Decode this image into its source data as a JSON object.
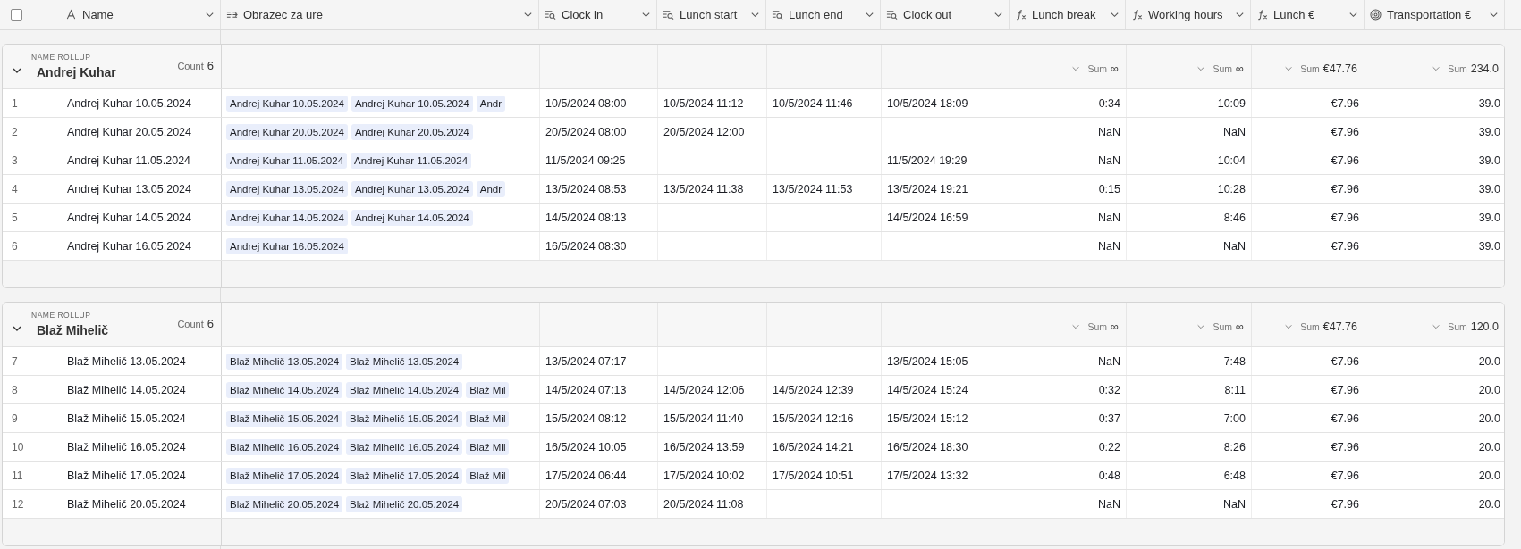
{
  "header": {
    "select_all": {
      "checked": false
    },
    "columns": [
      {
        "label": "Name",
        "kind": "text"
      },
      {
        "label": "Obrazec za ure",
        "kind": "link"
      },
      {
        "label": "Clock in",
        "kind": "lookup"
      },
      {
        "label": "Lunch start",
        "kind": "lookup"
      },
      {
        "label": "Lunch end",
        "kind": "lookup"
      },
      {
        "label": "Clock out",
        "kind": "lookup"
      },
      {
        "label": "Lunch break",
        "kind": "formula"
      },
      {
        "label": "Working hours",
        "kind": "formula"
      },
      {
        "label": "Lunch €",
        "kind": "formula"
      },
      {
        "label": "Transportation €",
        "kind": "rollup"
      }
    ]
  },
  "groups": [
    {
      "caption": "NAME ROLLUP",
      "name": "Andrej Kuhar",
      "count_label": "Count",
      "count": "6",
      "expanded": true,
      "summaries": [
        {
          "label": "Sum",
          "value": "∞"
        },
        {
          "label": "Sum",
          "value": "∞"
        },
        {
          "label": "Sum",
          "value": "€47.76"
        },
        {
          "label": "Sum",
          "value": "234.0"
        }
      ],
      "rows": [
        {
          "number": "1",
          "name": "Andrej Kuhar 10.05.2024",
          "links": [
            "Andrej Kuhar 10.05.2024",
            "Andrej Kuhar 10.05.2024",
            "Andr"
          ],
          "clock_in": "10/5/2024 08:00",
          "lunch_start": "10/5/2024 11:12",
          "lunch_end": "10/5/2024 11:46",
          "clock_out": "10/5/2024 18:09",
          "lunch_break": "0:34",
          "working_hours": "10:09",
          "lunch_eur": "€7.96",
          "transport": "39.0"
        },
        {
          "number": "2",
          "name": "Andrej Kuhar 20.05.2024",
          "links": [
            "Andrej Kuhar 20.05.2024",
            "Andrej Kuhar 20.05.2024"
          ],
          "clock_in": "20/5/2024 08:00",
          "lunch_start": "20/5/2024 12:00",
          "lunch_break": "NaN",
          "working_hours": "NaN",
          "lunch_eur": "€7.96",
          "transport": "39.0"
        },
        {
          "number": "3",
          "name": "Andrej Kuhar 11.05.2024",
          "links": [
            "Andrej Kuhar 11.05.2024",
            "Andrej Kuhar 11.05.2024"
          ],
          "clock_in": "11/5/2024 09:25",
          "clock_out": "11/5/2024 19:29",
          "lunch_break": "NaN",
          "working_hours": "10:04",
          "lunch_eur": "€7.96",
          "transport": "39.0"
        },
        {
          "number": "4",
          "name": "Andrej Kuhar 13.05.2024",
          "links": [
            "Andrej Kuhar 13.05.2024",
            "Andrej Kuhar 13.05.2024",
            "Andr"
          ],
          "clock_in": "13/5/2024 08:53",
          "lunch_start": "13/5/2024 11:38",
          "lunch_end": "13/5/2024 11:53",
          "clock_out": "13/5/2024 19:21",
          "lunch_break": "0:15",
          "working_hours": "10:28",
          "lunch_eur": "€7.96",
          "transport": "39.0"
        },
        {
          "number": "5",
          "name": "Andrej Kuhar 14.05.2024",
          "links": [
            "Andrej Kuhar 14.05.2024",
            "Andrej Kuhar 14.05.2024"
          ],
          "clock_in": "14/5/2024 08:13",
          "clock_out": "14/5/2024 16:59",
          "lunch_break": "NaN",
          "working_hours": "8:46",
          "lunch_eur": "€7.96",
          "transport": "39.0"
        },
        {
          "number": "6",
          "name": "Andrej Kuhar 16.05.2024",
          "links": [
            "Andrej Kuhar 16.05.2024"
          ],
          "clock_in": "16/5/2024 08:30",
          "lunch_break": "NaN",
          "working_hours": "NaN",
          "lunch_eur": "€7.96",
          "transport": "39.0"
        }
      ]
    },
    {
      "caption": "NAME ROLLUP",
      "name": "Blaž Mihelič",
      "count_label": "Count",
      "count": "6",
      "expanded": true,
      "summaries": [
        {
          "label": "Sum",
          "value": "∞"
        },
        {
          "label": "Sum",
          "value": "∞"
        },
        {
          "label": "Sum",
          "value": "€47.76"
        },
        {
          "label": "Sum",
          "value": "120.0"
        }
      ],
      "rows": [
        {
          "number": "7",
          "name": "Blaž Mihelič 13.05.2024",
          "links": [
            "Blaž Mihelič 13.05.2024",
            "Blaž Mihelič 13.05.2024"
          ],
          "clock_in": "13/5/2024 07:17",
          "clock_out": "13/5/2024 15:05",
          "lunch_break": "NaN",
          "working_hours": "7:48",
          "lunch_eur": "€7.96",
          "transport": "20.0"
        },
        {
          "number": "8",
          "name": "Blaž Mihelič 14.05.2024",
          "links": [
            "Blaž Mihelič 14.05.2024",
            "Blaž Mihelič 14.05.2024",
            "Blaž Mil"
          ],
          "clock_in": "14/5/2024 07:13",
          "lunch_start": "14/5/2024 12:06",
          "lunch_end": "14/5/2024 12:39",
          "clock_out": "14/5/2024 15:24",
          "lunch_break": "0:32",
          "working_hours": "8:11",
          "lunch_eur": "€7.96",
          "transport": "20.0"
        },
        {
          "number": "9",
          "name": "Blaž Mihelič 15.05.2024",
          "links": [
            "Blaž Mihelič 15.05.2024",
            "Blaž Mihelič 15.05.2024",
            "Blaž Mil"
          ],
          "clock_in": "15/5/2024 08:12",
          "lunch_start": "15/5/2024 11:40",
          "lunch_end": "15/5/2024 12:16",
          "clock_out": "15/5/2024 15:12",
          "lunch_break": "0:37",
          "working_hours": "7:00",
          "lunch_eur": "€7.96",
          "transport": "20.0"
        },
        {
          "number": "10",
          "name": "Blaž Mihelič 16.05.2024",
          "links": [
            "Blaž Mihelič 16.05.2024",
            "Blaž Mihelič 16.05.2024",
            "Blaž Mil"
          ],
          "clock_in": "16/5/2024 10:05",
          "lunch_start": "16/5/2024 13:59",
          "lunch_end": "16/5/2024 14:21",
          "clock_out": "16/5/2024 18:30",
          "lunch_break": "0:22",
          "working_hours": "8:26",
          "lunch_eur": "€7.96",
          "transport": "20.0"
        },
        {
          "number": "11",
          "name": "Blaž Mihelič 17.05.2024",
          "links": [
            "Blaž Mihelič 17.05.2024",
            "Blaž Mihelič 17.05.2024",
            "Blaž Mil"
          ],
          "clock_in": "17/5/2024 06:44",
          "lunch_start": "17/5/2024 10:02",
          "lunch_end": "17/5/2024 10:51",
          "clock_out": "17/5/2024 13:32",
          "lunch_break": "0:48",
          "working_hours": "6:48",
          "lunch_eur": "€7.96",
          "transport": "20.0"
        },
        {
          "number": "12",
          "name": "Blaž Mihelič 20.05.2024",
          "links": [
            "Blaž Mihelič 20.05.2024",
            "Blaž Mihelič 20.05.2024"
          ],
          "clock_in": "20/5/2024 07:03",
          "lunch_start": "20/5/2024 11:08",
          "lunch_break": "NaN",
          "working_hours": "NaN",
          "lunch_eur": "€7.96",
          "transport": "20.0"
        }
      ]
    }
  ]
}
